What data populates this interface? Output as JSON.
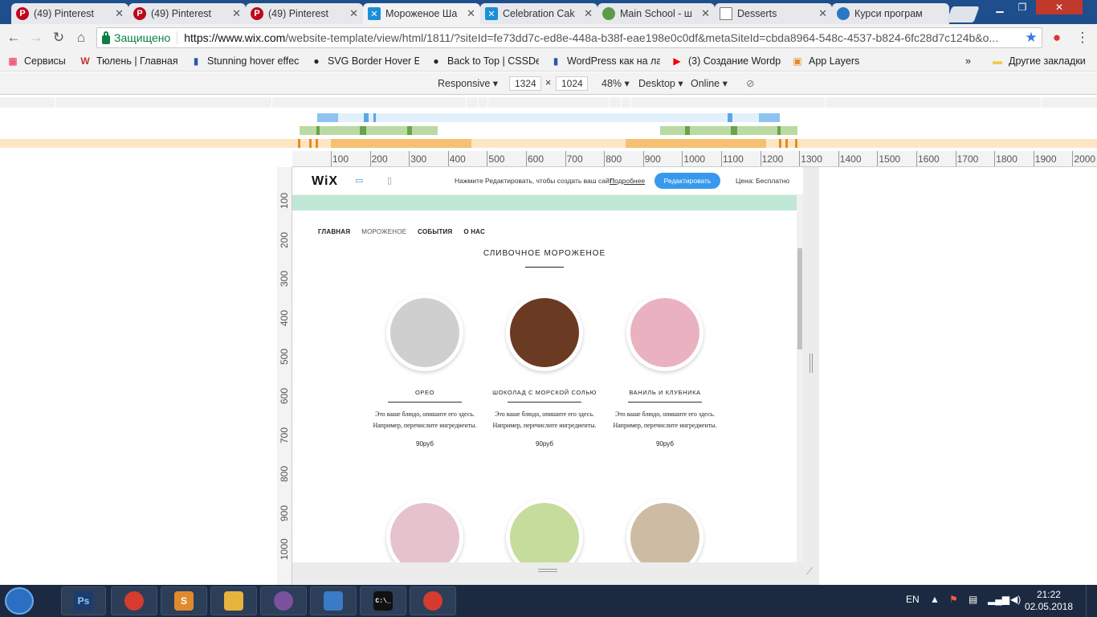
{
  "tabs": [
    {
      "title": "(49) Pinterest",
      "icon": "pinterest-icon",
      "color": "#bd081c"
    },
    {
      "title": "(49) Pinterest",
      "icon": "pinterest-icon",
      "color": "#bd081c"
    },
    {
      "title": "(49) Pinterest",
      "icon": "pinterest-icon",
      "color": "#bd081c"
    },
    {
      "title": "Мороженое Ша",
      "icon": "wix-icon",
      "color": "#1a8fd6"
    },
    {
      "title": "Celebration Cak",
      "icon": "wix-icon",
      "color": "#1a8fd6"
    },
    {
      "title": "Main School - ш",
      "icon": "globe-icon",
      "color": "#5b9a46"
    },
    {
      "title": "Desserts",
      "icon": "page-icon",
      "color": "#777777"
    },
    {
      "title": "Курси програм",
      "icon": "globe-icon",
      "color": "#2b78c2"
    }
  ],
  "toolbar": {
    "secure_label": "Защищено",
    "url_host": "https://www.wix.com",
    "url_path": "/website-template/view/html/1811/?siteId=fe73dd7c-ed8e-448a-b38f-eae198e0c0df&metaSiteId=cbda8964-548c-4537-b824-6fc28d7c124b&o..."
  },
  "bookmarks": [
    {
      "label": "Сервисы",
      "icon": "apps-grid-icon"
    },
    {
      "label": "Тюлень | Главная",
      "icon": "w-icon"
    },
    {
      "label": "Stunning hover effec",
      "icon": "bookmark-icon"
    },
    {
      "label": "SVG Border Hover Ef",
      "icon": "github-icon"
    },
    {
      "label": "Back to Top | CSSDe",
      "icon": "github-icon"
    },
    {
      "label": "WordPress как на ла",
      "icon": "bookmark-icon"
    },
    {
      "label": "(3) Создание Wordp",
      "icon": "youtube-icon"
    },
    {
      "label": "App Layers",
      "icon": "app-layers-icon"
    }
  ],
  "bookmarks_more": "»",
  "other_bookmarks": "Другие закладки",
  "devtools": {
    "mode": "Responsive",
    "width": "1324",
    "height": "1024",
    "times": "×",
    "zoom": "48%",
    "device": "Desktop",
    "network": "Online"
  },
  "ruler_h": [
    "100",
    "200",
    "300",
    "400",
    "500",
    "600",
    "700",
    "800",
    "900",
    "1000",
    "1100",
    "1200",
    "1300",
    "1400",
    "1500",
    "1600",
    "1700",
    "1800",
    "1900",
    "2000"
  ],
  "ruler_v": [
    "100",
    "200",
    "300",
    "400",
    "500",
    "600",
    "700",
    "800",
    "900",
    "1000"
  ],
  "wix": {
    "logo": "WiX",
    "prompt": "Нажмите Редактировать, чтобы создать ваш сайт!",
    "more_link": "Подробнее",
    "edit_button": "Редактировать",
    "price": "Цена: Бесплатно"
  },
  "site": {
    "nav": [
      "ГЛАВНАЯ",
      "МОРОЖЕНОЕ",
      "СОБЫТИЯ",
      "О НАС"
    ],
    "section_title": "СЛИВОЧНОЕ МОРОЖЕНОЕ",
    "products": [
      {
        "name": "ОРЕО",
        "desc": "Это ваше блюдо, опишите его здесь. Например, перечислите ингредиенты.",
        "price": "90руб",
        "color": "#cfcfcf"
      },
      {
        "name": "ШОКОЛАД С МОРСКОЙ СОЛЬЮ",
        "desc": "Это ваше блюдо, опишите его здесь. Например, перечислите ингредиенты.",
        "price": "90руб",
        "color": "#6b3a22"
      },
      {
        "name": "ВАНИЛЬ И КЛУБНИКА",
        "desc": "Это ваше блюдо, опишите его здесь. Например, перечислите ингредиенты.",
        "price": "90руб",
        "color": "#eab2c0"
      }
    ],
    "products_row2": [
      {
        "color": "#e6c2cc"
      },
      {
        "color": "#c5dc9c"
      },
      {
        "color": "#cdbca4"
      }
    ]
  },
  "taskbar": {
    "apps": [
      {
        "name": "photoshop",
        "label": "Ps",
        "color": "#1c3c6e"
      },
      {
        "name": "chrome",
        "label": "",
        "color": "#d63b2f"
      },
      {
        "name": "sublime",
        "label": "S",
        "color": "#e08a2d"
      },
      {
        "name": "explorer",
        "label": "",
        "color": "#e6b33d"
      },
      {
        "name": "viber",
        "label": "",
        "color": "#7b519d"
      },
      {
        "name": "control-panel",
        "label": "",
        "color": "#3a7bc8"
      },
      {
        "name": "cmd",
        "label": "C:\\_",
        "color": "#111111"
      },
      {
        "name": "chrome-2",
        "label": "",
        "color": "#d63b2f"
      }
    ],
    "lang": "EN",
    "time": "21:22",
    "date": "02.05.2018"
  },
  "colors": {
    "tabstrip": "#1f4e8c",
    "mint": "#bfe8d4",
    "edit_button": "#3899ec",
    "taskbar": "#1b2a40"
  }
}
